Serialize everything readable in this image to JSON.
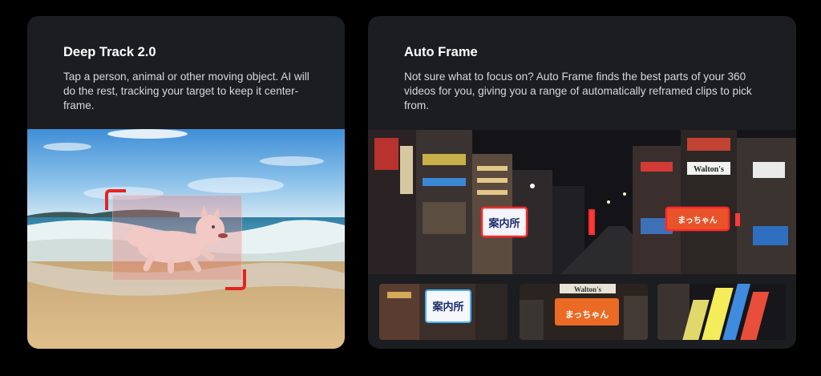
{
  "deep_track": {
    "title": "Deep Track 2.0",
    "description": "Tap a person, animal or other moving object. AI will do the rest, tracking your target to keep it center-frame."
  },
  "auto_frame": {
    "title": "Auto Frame",
    "description": "Not sure what to focus on? Auto Frame finds the best parts of your 360 videos for you, giving you a range of automatically reframed clips to pick from."
  },
  "signs": {
    "info_center": "案内所",
    "walton": "Walton's",
    "ramen": "まっちゃん"
  },
  "colors": {
    "card_bg": "#1c1d21",
    "tracking_red": "#e8231f",
    "highlight_red": "#ff2a2a"
  }
}
